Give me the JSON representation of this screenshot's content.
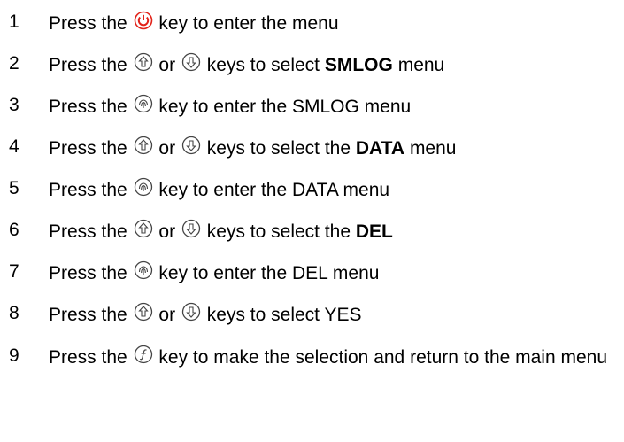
{
  "steps": [
    {
      "number": "1",
      "before": "Press the",
      "key1": "power-icon",
      "between": "",
      "key2": "",
      "after": "key to enter the menu",
      "bold": "",
      "tail": ""
    },
    {
      "number": "2",
      "before": "Press the",
      "key1": "up-arrow-icon",
      "between": "or",
      "key2": "down-arrow-icon",
      "after": "keys to select",
      "bold": "SMLOG",
      "tail": "menu"
    },
    {
      "number": "3",
      "before": "Press the",
      "key1": "enter-icon",
      "between": "",
      "key2": "",
      "after": "key to enter the SMLOG menu",
      "bold": "",
      "tail": ""
    },
    {
      "number": "4",
      "before": "Press the",
      "key1": "up-arrow-icon",
      "between": "or",
      "key2": "down-arrow-icon",
      "after": "keys to select the",
      "bold": "DATA",
      "tail": "menu"
    },
    {
      "number": "5",
      "before": "Press the",
      "key1": "enter-icon",
      "between": "",
      "key2": "",
      "after": "key to enter the DATA menu",
      "bold": "",
      "tail": ""
    },
    {
      "number": "6",
      "before": "Press the",
      "key1": "up-arrow-icon",
      "between": "or",
      "key2": "down-arrow-icon",
      "after": "keys to select the",
      "bold": "DEL",
      "tail": ""
    },
    {
      "number": "7",
      "before": "Press the",
      "key1": "enter-icon",
      "between": "",
      "key2": "",
      "after": "key to enter the DEL menu",
      "bold": "",
      "tail": ""
    },
    {
      "number": "8",
      "before": "Press the",
      "key1": "up-arrow-icon",
      "between": "or",
      "key2": "down-arrow-icon",
      "after": "keys to select YES",
      "bold": "",
      "tail": ""
    },
    {
      "number": "9",
      "before": "Press the",
      "key1": "function-icon",
      "between": "",
      "key2": "",
      "after": "key to make the selection and return to the main menu",
      "bold": "",
      "tail": ""
    }
  ],
  "colors": {
    "text": "#000000",
    "power_key": "#e2231a",
    "key_outline": "#444444"
  }
}
